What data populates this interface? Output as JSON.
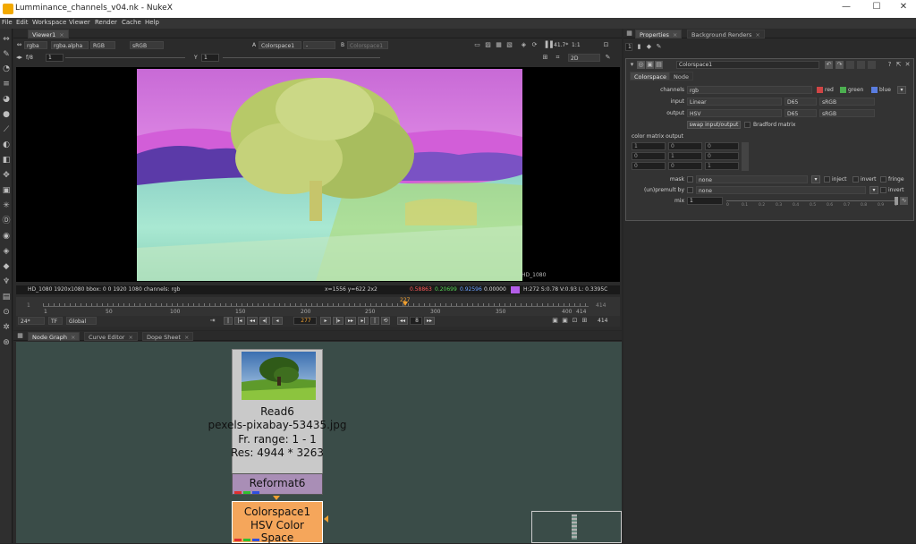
{
  "window": {
    "title": "Lumminance_channels_v04.nk - NukeX"
  },
  "menu": [
    "File",
    "Edit",
    "Workspace",
    "Viewer",
    "Render",
    "Cache",
    "Help"
  ],
  "viewer": {
    "tab": "Viewer1",
    "channels": "rgba",
    "alpha": "rgba.alpha",
    "display": "RGB",
    "colorspace": "sRGB",
    "input_a_label": "A",
    "input_a": "Colorspace1",
    "input_a_op": "-",
    "input_b_label": "B",
    "input_b": "Colorspace1",
    "zoom": "41.7*",
    "ratio": "1:1",
    "fstop": "f/8",
    "gain": "1",
    "gamma_label": "Y",
    "gamma": "1",
    "mode": "2D",
    "format_label": "HD_1080",
    "info": "HD_1080 1920x1080  bbox: 0 0 1920 1080  channels: rgb",
    "coords": "x=1556 y=622 2x2",
    "r": "0.58863",
    "g": "0.20699",
    "b": "0.92596",
    "a": "0.00000",
    "hsv": "H:272 S:0.78 V:0.93  L: 0.3395C",
    "timeline": {
      "start": "1",
      "end": "414",
      "ticks": [
        "1",
        "50",
        "100",
        "150",
        "200",
        "250",
        "300",
        "350",
        "400",
        "414"
      ],
      "current": "277",
      "marker": "227"
    },
    "play": {
      "fps": "24*",
      "tf": "TF",
      "global": "Global",
      "frame": "277",
      "step": "8",
      "end": "414"
    }
  },
  "properties": {
    "tabs": [
      "Properties",
      "Background Renders"
    ],
    "count": "1",
    "node_name": "Colorspace1",
    "subtabs": [
      "Colorspace",
      "Node"
    ],
    "channels_label": "channels",
    "channels": "rgb",
    "red": "red",
    "green": "green",
    "blue": "blue",
    "input_label": "input",
    "input": "Linear",
    "input_illum": "D65",
    "input_prim": "sRGB",
    "output_label": "output",
    "output": "HSV",
    "output_illum": "D65",
    "output_prim": "sRGB",
    "swap": "swap input/output",
    "bradford": "Bradford matrix",
    "matrix_label": "color matrix output",
    "matrix": [
      [
        "1",
        "0",
        "0"
      ],
      [
        "0",
        "1",
        "0"
      ],
      [
        "0",
        "0",
        "1"
      ]
    ],
    "mask_label": "mask",
    "mask": "none",
    "inject": "inject",
    "invert": "invert",
    "fringe": "fringe",
    "unpremult_label": "(un)premult by",
    "unpremult": "none",
    "invert2": "invert",
    "mix_label": "mix",
    "mix": "1",
    "mix_ticks": [
      "0",
      "0.1",
      "0.2",
      "0.3",
      "0.4",
      "0.5",
      "0.6",
      "0.7",
      "0.8",
      "0.9",
      "1"
    ]
  },
  "nodegraph": {
    "tabs": [
      "Node Graph",
      "Curve Editor",
      "Dope Sheet"
    ],
    "read": {
      "name": "Read6",
      "file": "pexels-pixabay-53435.jpg",
      "range": "Fr. range: 1 - 1",
      "res": "Res: 4944 * 3263"
    },
    "reformat": "Reformat6",
    "colorspace": {
      "name": "Colorspace1",
      "label": "HSV Color Space"
    }
  },
  "colors": {
    "accent": "#f5a65b",
    "read_node": "#c9c9c9",
    "reformat_node": "#a98eb6",
    "graph_bg": "#3a4c48"
  }
}
